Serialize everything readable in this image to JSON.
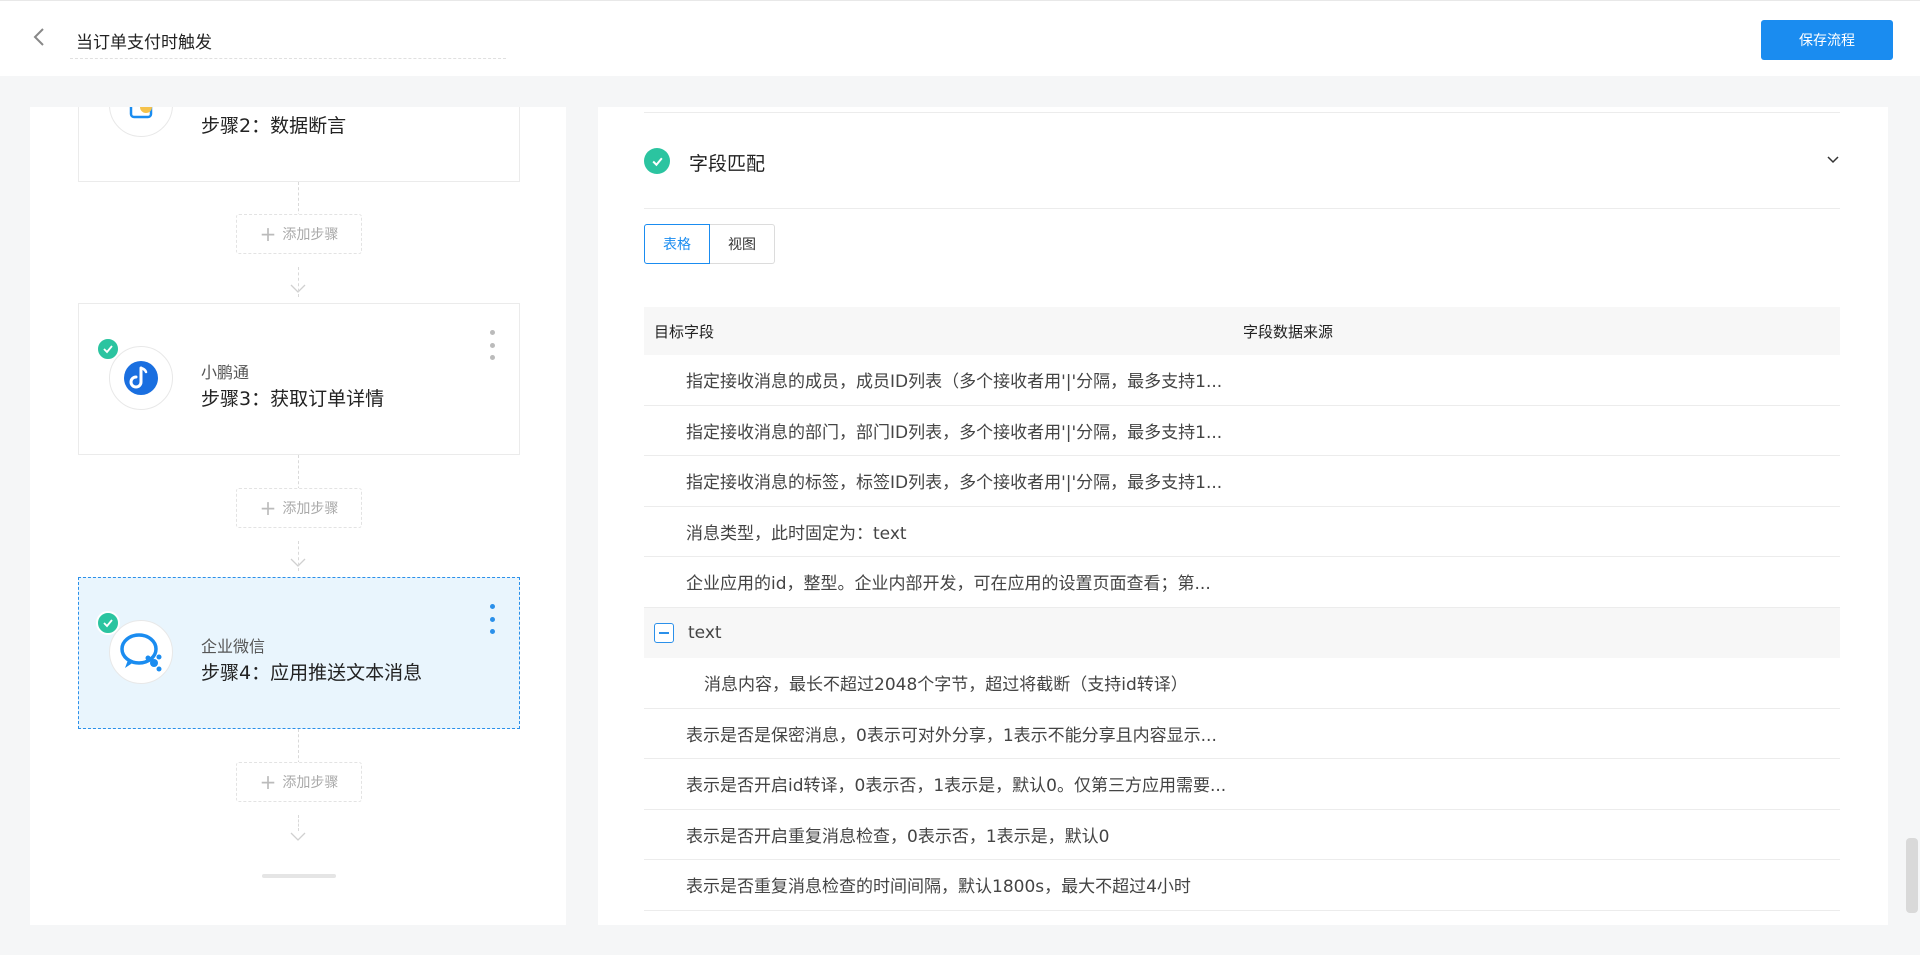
{
  "header": {
    "title_value": "当订单支付时触发",
    "save_label": "保存流程"
  },
  "flow": {
    "add_step_label": "添加步骤",
    "steps": [
      {
        "app": "",
        "name": "步骤2：数据断言",
        "icon": "data-assert-icon",
        "checked": false
      },
      {
        "app": "小鹏通",
        "name": "步骤3：获取订单详情",
        "icon": "xiaoetong-icon",
        "checked": true
      },
      {
        "app": "企业微信",
        "name": "步骤4：应用推送文本消息",
        "icon": "wecom-icon",
        "checked": true,
        "active": true
      }
    ]
  },
  "detail": {
    "section_title": "字段匹配",
    "tabs": [
      "表格",
      "视图"
    ],
    "active_tab": "表格",
    "columns": [
      "目标字段",
      "字段数据来源"
    ],
    "rows": [
      {
        "text": "指定接收消息的成员，成员ID列表（多个接收者用'|'分隔，最多支持1...",
        "kind": "normal"
      },
      {
        "text": "指定接收消息的部门，部门ID列表，多个接收者用'|'分隔，最多支持1...",
        "kind": "normal"
      },
      {
        "text": "指定接收消息的标签，标签ID列表，多个接收者用'|'分隔，最多支持1...",
        "kind": "normal"
      },
      {
        "text": "消息类型，此时固定为：text",
        "kind": "normal"
      },
      {
        "text": "企业应用的id，整型。企业内部开发，可在应用的设置页面查看；第...",
        "kind": "normal"
      },
      {
        "text": "text",
        "kind": "group"
      },
      {
        "text": "消息内容，最长不超过2048个字节，超过将截断（支持id转译）",
        "kind": "child"
      },
      {
        "text": "表示是否是保密消息，0表示可对外分享，1表示不能分享且内容显示...",
        "kind": "normal"
      },
      {
        "text": "表示是否开启id转译，0表示否，1表示是，默认0。仅第三方应用需要...",
        "kind": "normal"
      },
      {
        "text": "表示是否开启重复消息检查，0表示否，1表示是，默认0",
        "kind": "normal"
      },
      {
        "text": "表示是否重复消息检查的时间间隔，默认1800s，最大不超过4小时",
        "kind": "normal"
      }
    ]
  },
  "colors": {
    "accent": "#1a8cf0",
    "check": "#2bc4a0",
    "active_card_bg": "#e9f5fd"
  }
}
